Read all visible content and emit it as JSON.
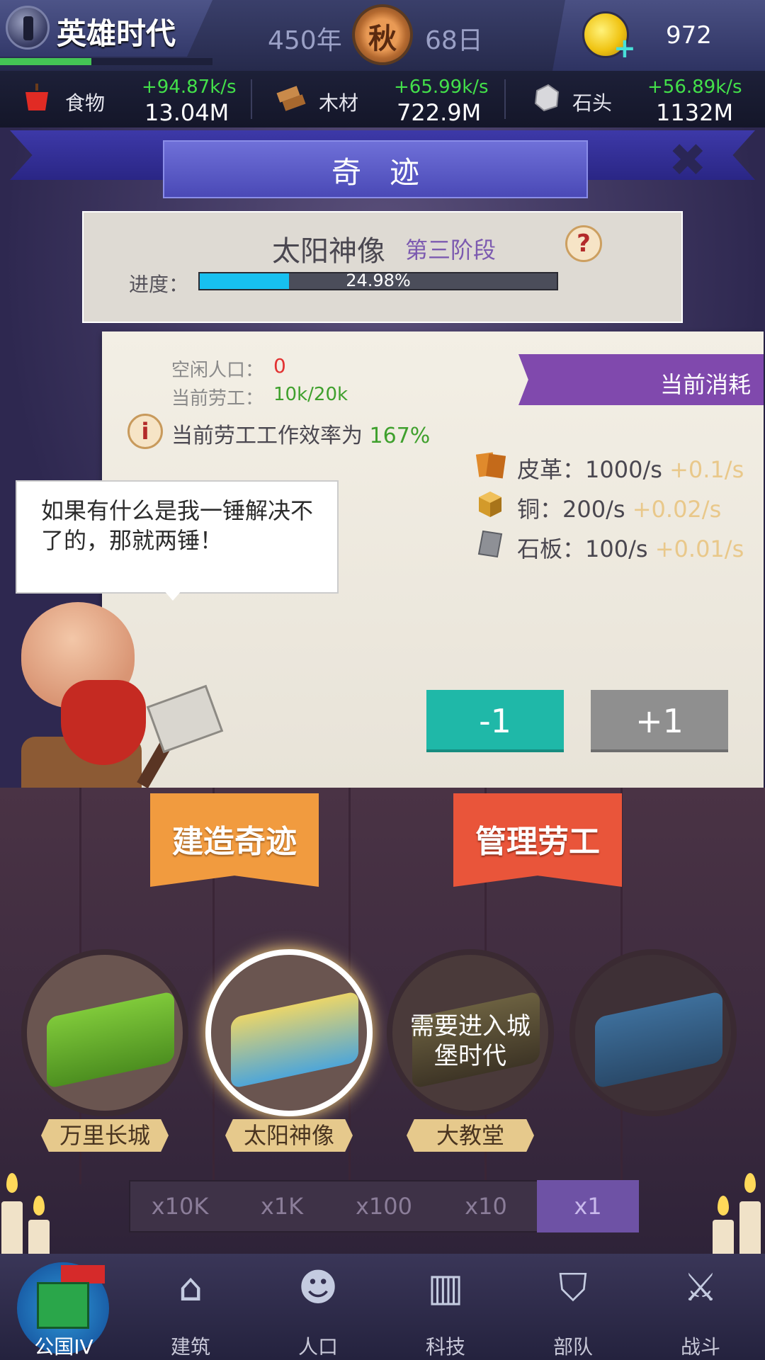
{
  "header": {
    "game_title": "英雄时代",
    "age_progress": 0.43,
    "year": "450年",
    "season": "秋",
    "day": "68日",
    "gold": "972"
  },
  "resources": [
    {
      "name": "食物",
      "rate": "+94.87k/s",
      "total": "13.04M",
      "icon": "apple-icon"
    },
    {
      "name": "木材",
      "rate": "+65.99k/s",
      "total": "722.9M",
      "icon": "wood-icon"
    },
    {
      "name": "石头",
      "rate": "+56.89k/s",
      "total": "1132M",
      "icon": "stone-icon"
    }
  ],
  "panel": {
    "title": "奇迹",
    "wonder_name": "太阳神像",
    "stage": "第三阶段",
    "help": "?",
    "progress_label": "进度：",
    "progress_value": 0.2498,
    "progress_text": "24.98%"
  },
  "workers": {
    "idle_label": "空闲人口：",
    "idle_value": "0",
    "labor_label": "当前劳工：",
    "labor_value": "10k/20k",
    "info": "i",
    "efficiency_text": "当前劳工工作效率为",
    "efficiency_value": "167%"
  },
  "consumption": {
    "title": "当前消耗",
    "items": [
      {
        "name": "皮革：",
        "rate": "1000/s",
        "inc": "+0.1/s",
        "icon": "leather-icon"
      },
      {
        "name": "铜：",
        "rate": "200/s",
        "inc": "+0.02/s",
        "icon": "copper-icon"
      },
      {
        "name": "石板：",
        "rate": "100/s",
        "inc": "+0.01/s",
        "icon": "slate-icon"
      }
    ]
  },
  "buttons": {
    "minus": "-1",
    "plus": "+1"
  },
  "speech": "如果有什么是我一锤解决不了的，那就两锤！",
  "tabs": {
    "build": "建造奇迹",
    "manage": "管理劳工"
  },
  "wonders": [
    {
      "name": "万里长城",
      "locked_text": ""
    },
    {
      "name": "太阳神像",
      "locked_text": ""
    },
    {
      "name": "大教堂",
      "locked_text": "需要进入城堡时代"
    },
    {
      "name": "",
      "locked_text": ""
    }
  ],
  "multipliers": [
    "x10K",
    "x1K",
    "x100",
    "x10",
    "x1"
  ],
  "selected_multiplier": "x1",
  "nav": [
    {
      "label": "公国IV",
      "icon": "castle-icon"
    },
    {
      "label": "建筑",
      "icon": "house-icon"
    },
    {
      "label": "人口",
      "icon": "person-icon"
    },
    {
      "label": "科技",
      "icon": "book-icon"
    },
    {
      "label": "部队",
      "icon": "banner-icon"
    },
    {
      "label": "战斗",
      "icon": "swords-icon"
    }
  ],
  "colors": {
    "accent_green": "#43e04a",
    "purple": "#8049ad",
    "teal": "#1fb8a8",
    "orange": "#f19b3f",
    "red_tab": "#e9553a"
  }
}
